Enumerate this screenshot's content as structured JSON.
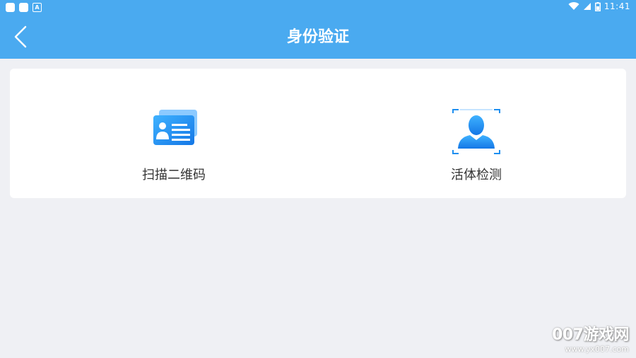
{
  "status_bar": {
    "time": "11:41"
  },
  "nav": {
    "title": "身份验证"
  },
  "options": [
    {
      "label": "扫描二维码",
      "icon": "id-card-icon"
    },
    {
      "label": "活体检测",
      "icon": "face-scan-icon"
    }
  ],
  "watermark": {
    "logo": "007游戏网",
    "url": "www.yx007.com"
  },
  "colors": {
    "header": "#4aaaf0",
    "background": "#eff0f4",
    "icon_blue": "#1e8ff0"
  }
}
